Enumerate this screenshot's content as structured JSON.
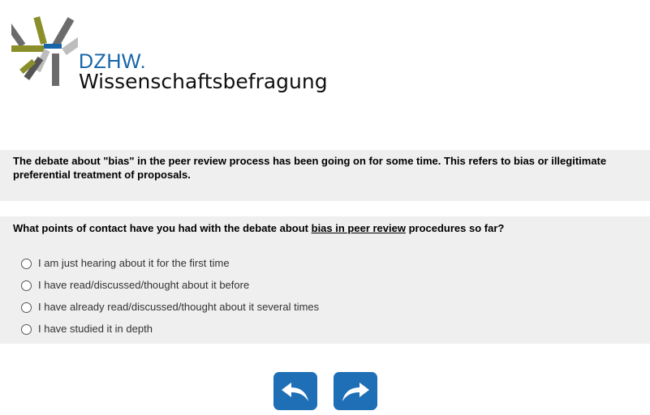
{
  "logo": {
    "brand": "DZHW.",
    "name": "Wissenschaftsbefragung"
  },
  "intro": {
    "text": "The debate about \"bias\" in the peer review process has been going on for some time. This refers to bias or illegitimate preferential treatment of proposals."
  },
  "question": {
    "text_before": "What points of contact have you had with the debate about ",
    "text_underlined": "bias in peer review",
    "text_after": " procedures so far?",
    "options": [
      "I am just hearing about it for the first time",
      "I have read/discussed/thought about it before",
      "I have already read/discussed/thought about it several times",
      "I have studied it in depth"
    ]
  },
  "nav": {
    "back_icon": "undo-arrow-icon",
    "next_icon": "redo-arrow-icon"
  },
  "colors": {
    "button_blue": "#1e6fb6",
    "brand_blue": "#1565a8",
    "block_gray": "#efefef"
  }
}
